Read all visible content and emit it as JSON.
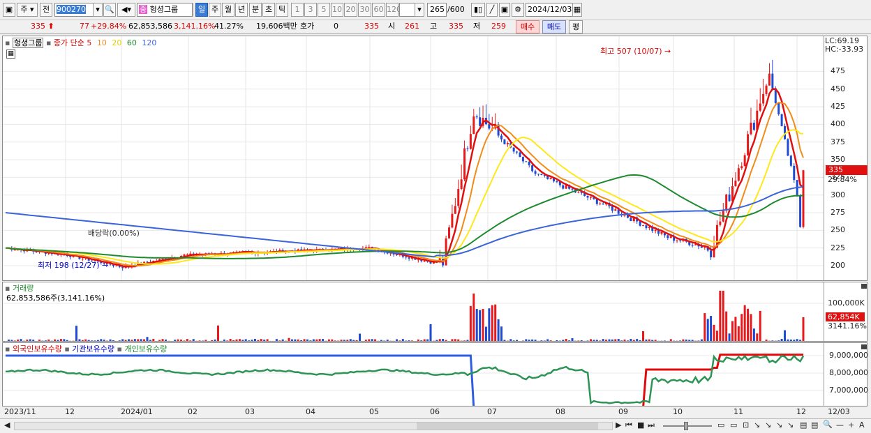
{
  "toolbar": {
    "market": "주",
    "prev": "전",
    "code": "900270",
    "name_badge": "중",
    "name": "헝셩그룹",
    "periods": [
      "일",
      "주",
      "월",
      "년",
      "분",
      "초",
      "틱"
    ],
    "intervals": [
      "1",
      "3",
      "5",
      "10",
      "20",
      "30",
      "60",
      "120"
    ],
    "count": "265",
    "count_max": "/600",
    "date": "2024/12/03"
  },
  "quote": {
    "price": "335",
    "change": "77",
    "change_rate": "+29.84%",
    "volume": "62,853,586",
    "volume_rate": "3,141.16%",
    "turnover": "41.27%",
    "amount": "19,606백만",
    "hoga_label": "호가",
    "hoga_val": "0",
    "hoga_price": "335",
    "open_label": "시",
    "open": "261",
    "high_label": "고",
    "high": "335",
    "low_label": "저",
    "low": "259",
    "buy": "매수",
    "sell": "매도",
    "avg": "평"
  },
  "price_panel": {
    "title": "헝셩그룹",
    "ma_label": "종가 단순",
    "ma_periods": [
      "5",
      "10",
      "20",
      "60",
      "120"
    ],
    "lc": "LC:69.19",
    "hc": "HC:-33.93",
    "annotations": {
      "high": "최고 507 (10/07)",
      "low": "최저 198 (12/27)",
      "dividend": "배당락(0.00%)"
    },
    "current_price": "335",
    "current_rate": "29.84%",
    "y_ticks": [
      "475",
      "450",
      "425",
      "400",
      "375",
      "350",
      "325",
      "300",
      "275",
      "250",
      "225",
      "200"
    ]
  },
  "volume_panel": {
    "title": "거래량",
    "info": "62,853,586주(3,141.16%)",
    "y_tick": "100,000K",
    "current": "62,854K",
    "current_rate": "3141.16%"
  },
  "holder_panel": {
    "legend": [
      "외국인보유수량",
      "기관보유수량",
      "개인보유수량"
    ],
    "y_ticks": [
      "9,000,000",
      "8,000,000",
      "7,000,000"
    ]
  },
  "x_axis": {
    "labels": [
      "2023/11",
      "12",
      "2024/01",
      "02",
      "03",
      "04",
      "05",
      "06",
      "07",
      "08",
      "09",
      "10",
      "11",
      "12"
    ],
    "end_date": "12/03"
  },
  "colors": {
    "up": "#e8191b",
    "down": "#1e4bd1",
    "ma5": "#e01010",
    "ma10": "#f08c1a",
    "ma20": "#ffe81a",
    "ma60": "#1e8a2e",
    "ma120": "#3a64d8"
  },
  "chart_data": {
    "type": "line",
    "title": "헝셩그룹",
    "ylim": [
      190,
      500
    ],
    "price_milestones": [
      {
        "date": "2023/11",
        "close": 225
      },
      {
        "date": "2023/12/27",
        "close": 198
      },
      {
        "date": "2024/01",
        "close": 215
      },
      {
        "date": "2024/02",
        "close": 225
      },
      {
        "date": "2024/05",
        "close": 205
      },
      {
        "date": "2024/05/28",
        "close": 420
      },
      {
        "date": "2024/06",
        "close": 330
      },
      {
        "date": "2024/07",
        "close": 285
      },
      {
        "date": "2024/08",
        "close": 240
      },
      {
        "date": "2024/09",
        "close": 225
      },
      {
        "date": "2024/10/07",
        "close": 507
      },
      {
        "date": "2024/11",
        "close": 300
      },
      {
        "date": "2024/12/02",
        "close": 258
      },
      {
        "date": "2024/12/03",
        "close": 335
      }
    ],
    "high": {
      "date": "10/07",
      "value": 507
    },
    "low": {
      "date": "12/27",
      "value": 198
    },
    "last": {
      "close": 335,
      "change_rate": 29.84
    }
  }
}
